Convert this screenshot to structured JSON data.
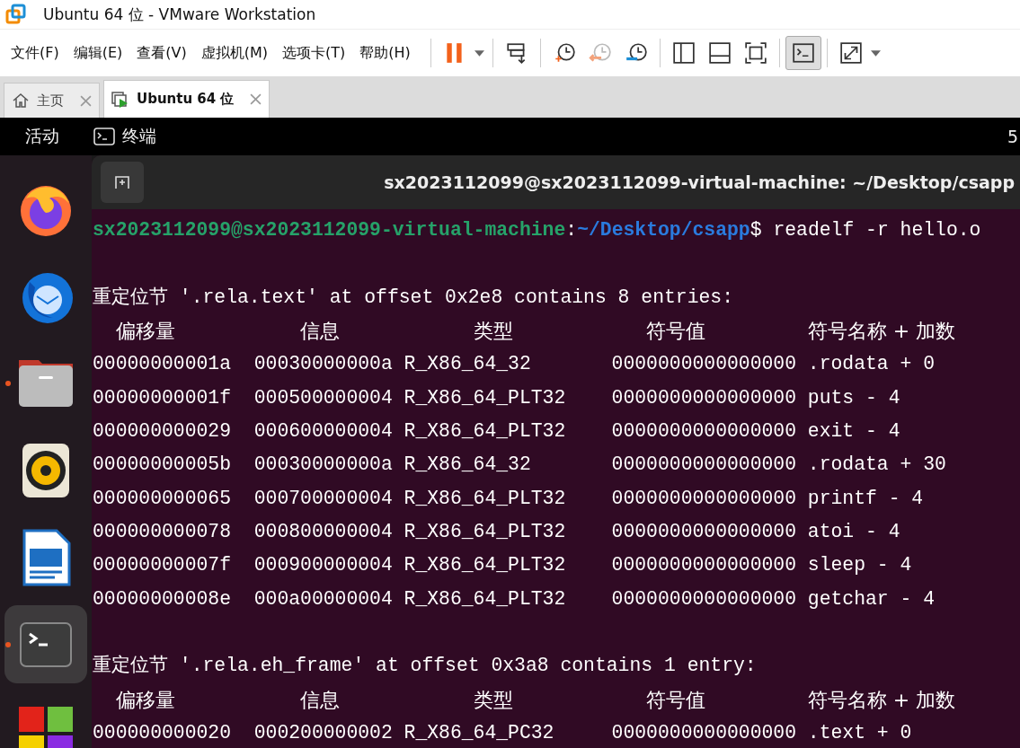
{
  "window": {
    "title": "Ubuntu 64 位 - VMware Workstation"
  },
  "menu": [
    "文件(F)",
    "编辑(E)",
    "查看(V)",
    "虚拟机(M)",
    "选项卡(T)",
    "帮助(H)"
  ],
  "toolbar": [
    [
      {
        "kind": "pause",
        "selected": false
      },
      {
        "kind": "caret",
        "selected": false
      }
    ],
    [
      {
        "kind": "send-keys",
        "selected": false
      }
    ],
    [
      {
        "kind": "snapshot",
        "selected": false
      },
      {
        "kind": "revert",
        "selected": false
      },
      {
        "kind": "manager",
        "selected": false
      }
    ],
    [
      {
        "kind": "sidebar",
        "selected": false
      },
      {
        "kind": "thumbnail",
        "selected": false
      },
      {
        "kind": "fit",
        "selected": false
      }
    ],
    [
      {
        "kind": "console",
        "selected": true
      }
    ],
    [
      {
        "kind": "stretch",
        "selected": false
      },
      {
        "kind": "caret",
        "selected": false
      }
    ]
  ],
  "tabs": [
    {
      "label": "主页",
      "kind": "home",
      "selected": false
    },
    {
      "label": "Ubuntu 64 位",
      "kind": "vm",
      "selected": true
    }
  ],
  "topbar": {
    "activities": "活动",
    "app": "终端",
    "clock": "5"
  },
  "dock": [
    {
      "kind": "firefox",
      "running": false,
      "selected": false
    },
    {
      "kind": "thunderbird",
      "running": false,
      "selected": false
    },
    {
      "kind": "files",
      "running": true,
      "selected": false
    },
    {
      "kind": "rhythmbox",
      "running": false,
      "selected": false
    },
    {
      "kind": "writer",
      "running": false,
      "selected": false
    },
    {
      "kind": "terminal",
      "running": true,
      "selected": true
    },
    {
      "kind": "software",
      "running": false,
      "selected": false
    }
  ],
  "terminal": {
    "title": "sx2023112099@sx2023112099-virtual-machine: ~/Desktop/csapp",
    "prompt": {
      "user_host": "sx2023112099@sx2023112099-virtual-machine",
      "separator": ":",
      "path": "~/Desktop/csapp",
      "command": "$ readelf -r hello.o"
    },
    "sections": [
      {
        "heading": "重定位节 '.rela.text' at offset 0x2e8 contains 8 entries:",
        "columns": [
          "偏移量",
          "信息",
          "类型",
          "符号值",
          "符号名称 + 加数"
        ],
        "rows": [
          [
            "00000000001a",
            "00030000000a",
            "R_X86_64_32",
            "0000000000000000",
            ".rodata + 0"
          ],
          [
            "00000000001f",
            "000500000004",
            "R_X86_64_PLT32",
            "0000000000000000",
            "puts - 4"
          ],
          [
            "000000000029",
            "000600000004",
            "R_X86_64_PLT32",
            "0000000000000000",
            "exit - 4"
          ],
          [
            "00000000005b",
            "00030000000a",
            "R_X86_64_32",
            "0000000000000000",
            ".rodata + 30"
          ],
          [
            "000000000065",
            "000700000004",
            "R_X86_64_PLT32",
            "0000000000000000",
            "printf - 4"
          ],
          [
            "000000000078",
            "000800000004",
            "R_X86_64_PLT32",
            "0000000000000000",
            "atoi - 4"
          ],
          [
            "00000000007f",
            "000900000004",
            "R_X86_64_PLT32",
            "0000000000000000",
            "sleep - 4"
          ],
          [
            "00000000008e",
            "000a00000004",
            "R_X86_64_PLT32",
            "0000000000000000",
            "getchar - 4"
          ]
        ]
      },
      {
        "heading": "重定位节 '.rela.eh_frame' at offset 0x3a8 contains 1 entry:",
        "columns": [
          "偏移量",
          "信息",
          "类型",
          "符号值",
          "符号名称 + 加数"
        ],
        "rows": [
          [
            "000000000020",
            "000200000002",
            "R_X86_64_PC32",
            "0000000000000000",
            ".text + 0"
          ]
        ]
      }
    ]
  }
}
